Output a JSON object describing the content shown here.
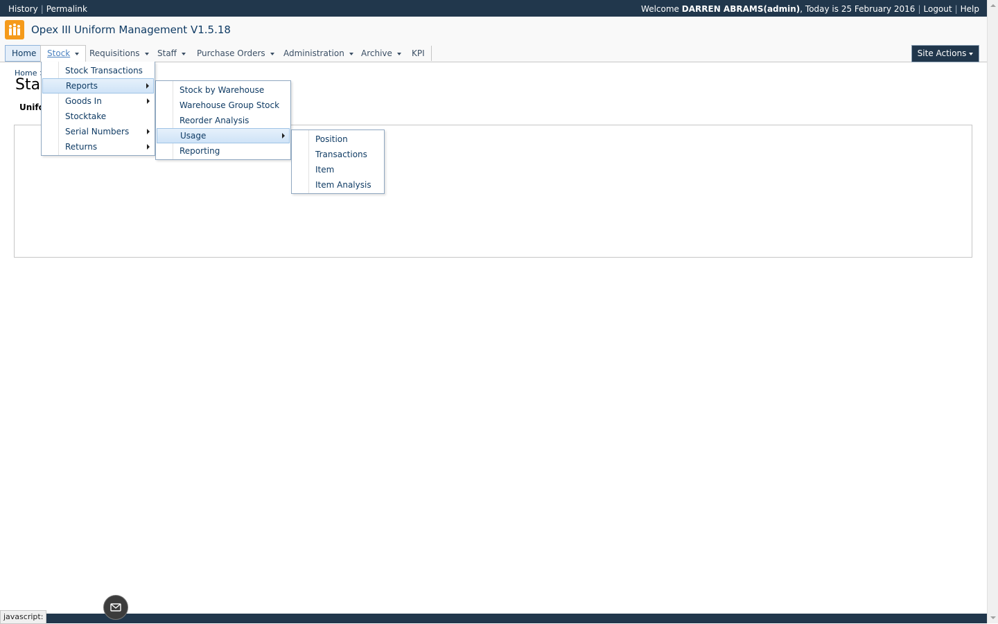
{
  "topbar": {
    "history": "History",
    "permalink": "Permalink",
    "welcome_prefix": "Welcome ",
    "user": "DARREN ABRAMS(admin)",
    "date_text": ", Today is 25 February 2016",
    "logout": "Logout",
    "help": "Help",
    "separator": "|"
  },
  "header": {
    "title": "Opex III Uniform Management V1.5.18"
  },
  "nav": {
    "home": "Home",
    "stock": "Stock",
    "requisitions": "Requisitions",
    "staff": "Staff",
    "purchase_orders": "Purchase Orders",
    "administration": "Administration",
    "archive": "Archive",
    "kpi": "KPI",
    "site_actions": "Site Actions"
  },
  "page": {
    "breadcrumb": "Home >",
    "title": "Sta",
    "subtitle": "Unifo"
  },
  "menus": {
    "stock": [
      "Stock Transactions",
      "Reports",
      "Goods In",
      "Stocktake",
      "Serial Numbers",
      "Returns"
    ],
    "reports": [
      "Stock by Warehouse",
      "Warehouse Group Stock",
      "Reorder Analysis",
      "Usage",
      "Reporting"
    ],
    "usage": [
      "Position",
      "Transactions",
      "Item",
      "Item Analysis"
    ]
  },
  "status": {
    "text": "javascript:"
  },
  "colors": {
    "topbar": "#21374c",
    "link": "#0f3b64",
    "logo": "#f59a1a",
    "menu_highlight": "#cfe3f7"
  }
}
